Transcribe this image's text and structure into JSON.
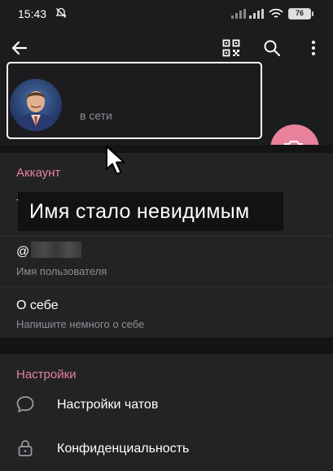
{
  "status_bar": {
    "time": "15:43",
    "battery": "76"
  },
  "profile": {
    "status": "в сети"
  },
  "overlay": {
    "caption": "Имя стало невидимым"
  },
  "account": {
    "title": "Аккаунт",
    "phone_prefix": "+7",
    "username_prefix": "@",
    "username_label": "Имя пользователя",
    "bio_title": "О себе",
    "bio_hint": "Напишите немного о себе"
  },
  "settings": {
    "title": "Настройки",
    "items": [
      {
        "label": "Настройки чатов",
        "icon": "chat-bubble-icon"
      },
      {
        "label": "Конфиденциальность",
        "icon": "lock-icon"
      }
    ]
  },
  "colors": {
    "accent": "#e8819c",
    "background": "#1c1c1e",
    "muted": "#8e8e93"
  }
}
